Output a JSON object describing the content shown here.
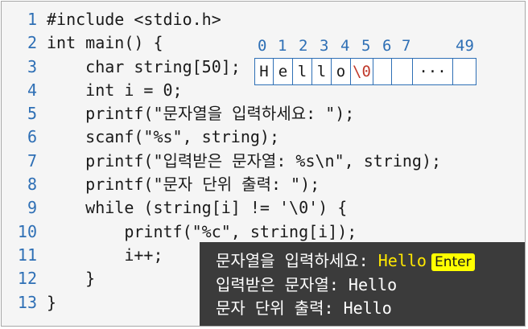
{
  "code": {
    "lines": [
      {
        "num": "1",
        "text": "#include <stdio.h>"
      },
      {
        "num": "2",
        "text": "int main() {"
      },
      {
        "num": "3",
        "text": "    char string[50];"
      },
      {
        "num": "4",
        "text": "    int i = 0;"
      },
      {
        "num": "5",
        "text": "    printf(\"문자열을 입력하세요: \");"
      },
      {
        "num": "6",
        "text": "    scanf(\"%s\", string);"
      },
      {
        "num": "7",
        "text": "    printf(\"입력받은 문자열: %s\\n\", string);"
      },
      {
        "num": "8",
        "text": "    printf(\"문자 단위 출력: \");"
      },
      {
        "num": "9",
        "text": "    while (string[i] != '\\0') {"
      },
      {
        "num": "10",
        "text": "        printf(\"%c\", string[i]);"
      },
      {
        "num": "11",
        "text": "        i++;"
      },
      {
        "num": "12",
        "text": "    }"
      },
      {
        "num": "13",
        "text": "}"
      }
    ]
  },
  "array": {
    "indices": [
      "0",
      "1",
      "2",
      "3",
      "4",
      "5",
      "6",
      "7",
      "49"
    ],
    "cells": [
      "H",
      "e",
      "l",
      "l",
      "o",
      "\\0",
      "",
      "",
      "···",
      ""
    ]
  },
  "console": {
    "line1_label": "문자열을 입력하세요: ",
    "line1_input": "Hello",
    "enter_key": "Enter",
    "line2": "입력받은 문자열: Hello",
    "line3": "문자 단위 출력: Hello"
  },
  "colors": {
    "line_number": "#2e6fb5",
    "null_char": "#c0392b",
    "console_bg": "#3b3b3b",
    "input_highlight": "#ffe800"
  }
}
